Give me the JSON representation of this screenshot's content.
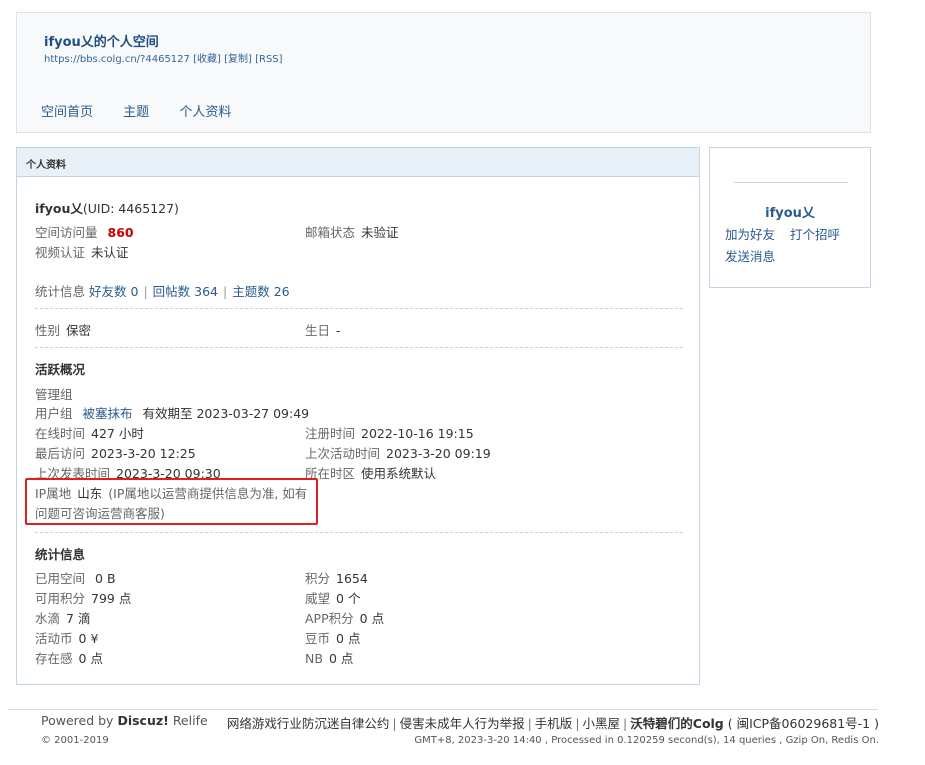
{
  "header": {
    "title": "ifyou乂的个人空间",
    "url": "https://bbs.colg.cn/?4465127",
    "actions": [
      "[收藏]",
      "[复制]",
      "[RSS]"
    ],
    "nav": [
      "空间首页",
      "主题",
      "个人资料"
    ]
  },
  "panel": {
    "title": "个人资料",
    "username": "ifyou乂",
    "uid": "(UID: 4465127)",
    "visits_label": "空间访问量",
    "visits_value": "860",
    "email_label": "邮箱状态",
    "email_value": "未验证",
    "video_label": "视频认证",
    "video_value": "未认证",
    "stats_label": "统计信息",
    "stats_links": [
      "好友数 0",
      "回帖数 364",
      "主题数 26"
    ],
    "gender_label": "性别",
    "gender_value": "保密",
    "birthday_label": "生日",
    "birthday_value": "-",
    "activity": {
      "title": "活跃概况",
      "admin_group": "管理组",
      "usergroup_label": "用户组",
      "usergroup_value": "被塞抹布",
      "usergroup_expiry": "有效期至 2023-03-27 09:49",
      "online_label": "在线时间",
      "online_value": "427 小时",
      "reg_label": "注册时间",
      "reg_value": "2022-10-16 19:15",
      "lastvisit_label": "最后访问",
      "lastvisit_value": "2023-3-20 12:25",
      "lastactive_label": "上次活动时间",
      "lastactive_value": "2023-3-20 09:19",
      "lastpost_label": "上次发表时间",
      "lastpost_value": "2023-3-20 09:30",
      "timezone_label": "所在时区",
      "timezone_value": "使用系统默认",
      "ip_label": "IP属地",
      "ip_value": "山东",
      "ip_note": "(IP属地以运营商提供信息为准, 如有问题可咨询运营商客服)"
    },
    "statistics": {
      "title": "统计信息",
      "left": [
        {
          "label": "已用空间",
          "value": "0 B"
        },
        {
          "label": "可用积分",
          "value": "799 点"
        },
        {
          "label": "水滴",
          "value": "7 滴"
        },
        {
          "label": "活动币",
          "value": "0 ¥"
        },
        {
          "label": "存在感",
          "value": "0 点"
        }
      ],
      "right": [
        {
          "label": "积分",
          "value": "1654"
        },
        {
          "label": "威望",
          "value": "0 个"
        },
        {
          "label": "APP积分",
          "value": "0 点"
        },
        {
          "label": "豆币",
          "value": "0 点"
        },
        {
          "label": "NB",
          "value": "0 点"
        }
      ]
    }
  },
  "sidebar": {
    "name": "ifyou乂",
    "add_friend": "加为好友",
    "greet": "打个招呼",
    "message": "发送消息"
  },
  "footer": {
    "powered_prefix": "Powered by",
    "powered_brand": "Discuz!",
    "powered_suffix": "Relife",
    "copyright": "© 2001-2019",
    "links": [
      "网络游戏行业防沉迷自律公约",
      "侵害未成年人行为举报",
      "手机版",
      "小黑屋"
    ],
    "site_name": "沃特碧们的Colg",
    "icp": "( 闽ICP备06029681号-1 )",
    "stats_line": "GMT+8, 2023-3-20 14:40 , Processed in 0.120259 second(s), 14 queries , Gzip On, Redis On."
  },
  "colors": {
    "link": "#336699",
    "highlight_red": "#cc0000",
    "annotation_box": "#e02020",
    "panel_header_bg": "#e8f0f8"
  }
}
